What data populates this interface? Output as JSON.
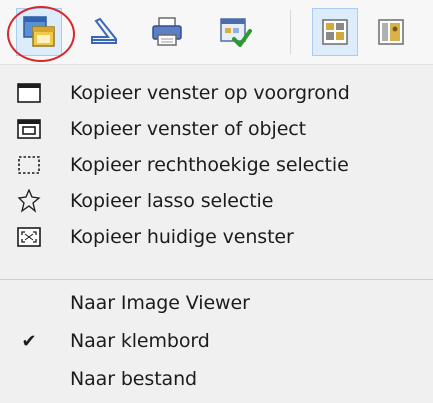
{
  "toolbar": {
    "buttons": [
      {
        "icon": "copy-window-icon",
        "pressed": true
      },
      {
        "icon": "scanner-icon",
        "pressed": false
      },
      {
        "icon": "printer-icon",
        "pressed": false
      },
      {
        "icon": "save-check-icon",
        "pressed": false
      },
      {
        "icon": "layout-grid-icon",
        "pressed": true
      },
      {
        "icon": "layout-portrait-icon",
        "pressed": false
      }
    ],
    "highlight_color": "#d9262b",
    "pressed_color": "#dcecfa"
  },
  "menu": {
    "capture_items": [
      {
        "label": "Kopieer venster op voorgrond",
        "icon": "window-icon"
      },
      {
        "label": "Kopieer venster of object",
        "icon": "window-object-icon"
      },
      {
        "label": "Kopieer rechthoekige selectie",
        "icon": "rect-selection-icon"
      },
      {
        "label": "Kopieer lasso selectie",
        "icon": "lasso-icon"
      },
      {
        "label": "Kopieer huidige venster",
        "icon": "fullscreen-icon"
      }
    ],
    "output_items": [
      {
        "label": "Naar Image Viewer",
        "checked": false
      },
      {
        "label": "Naar klembord",
        "checked": true
      },
      {
        "label": "Naar bestand",
        "checked": false
      }
    ],
    "check_glyph": "✔"
  }
}
